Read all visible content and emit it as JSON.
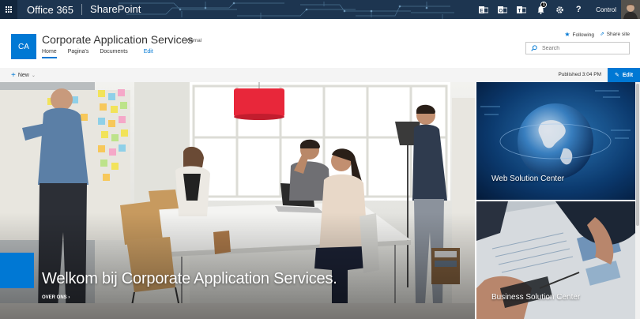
{
  "suitebar": {
    "brand": "Office 365",
    "app": "SharePoint",
    "notification_count": "1",
    "user": "Control",
    "icons": [
      "exchange-icon",
      "outlook-icon",
      "teams-icon",
      "notifications-icon",
      "settings-icon",
      "help-icon"
    ]
  },
  "site": {
    "logo": "CA",
    "title": "Corporate Application Services",
    "classification": "Internal",
    "nav": [
      "Home",
      "Pagina's",
      "Documents"
    ],
    "edit_link": "Edit",
    "follow": "Following",
    "share": "Share site",
    "search_placeholder": "Search"
  },
  "commandbar": {
    "new_label": "New",
    "published": "Published 3:04 PM",
    "edit_label": "Edit"
  },
  "hero": {
    "title": "Welkom bij Corporate Application Services.",
    "link": "OVER ONS",
    "tiles": [
      {
        "label": "Web Solution Center"
      },
      {
        "label": "Business Solution Center"
      }
    ]
  },
  "colors": {
    "accent": "#0078d4",
    "suitebar": "#1d3550"
  }
}
